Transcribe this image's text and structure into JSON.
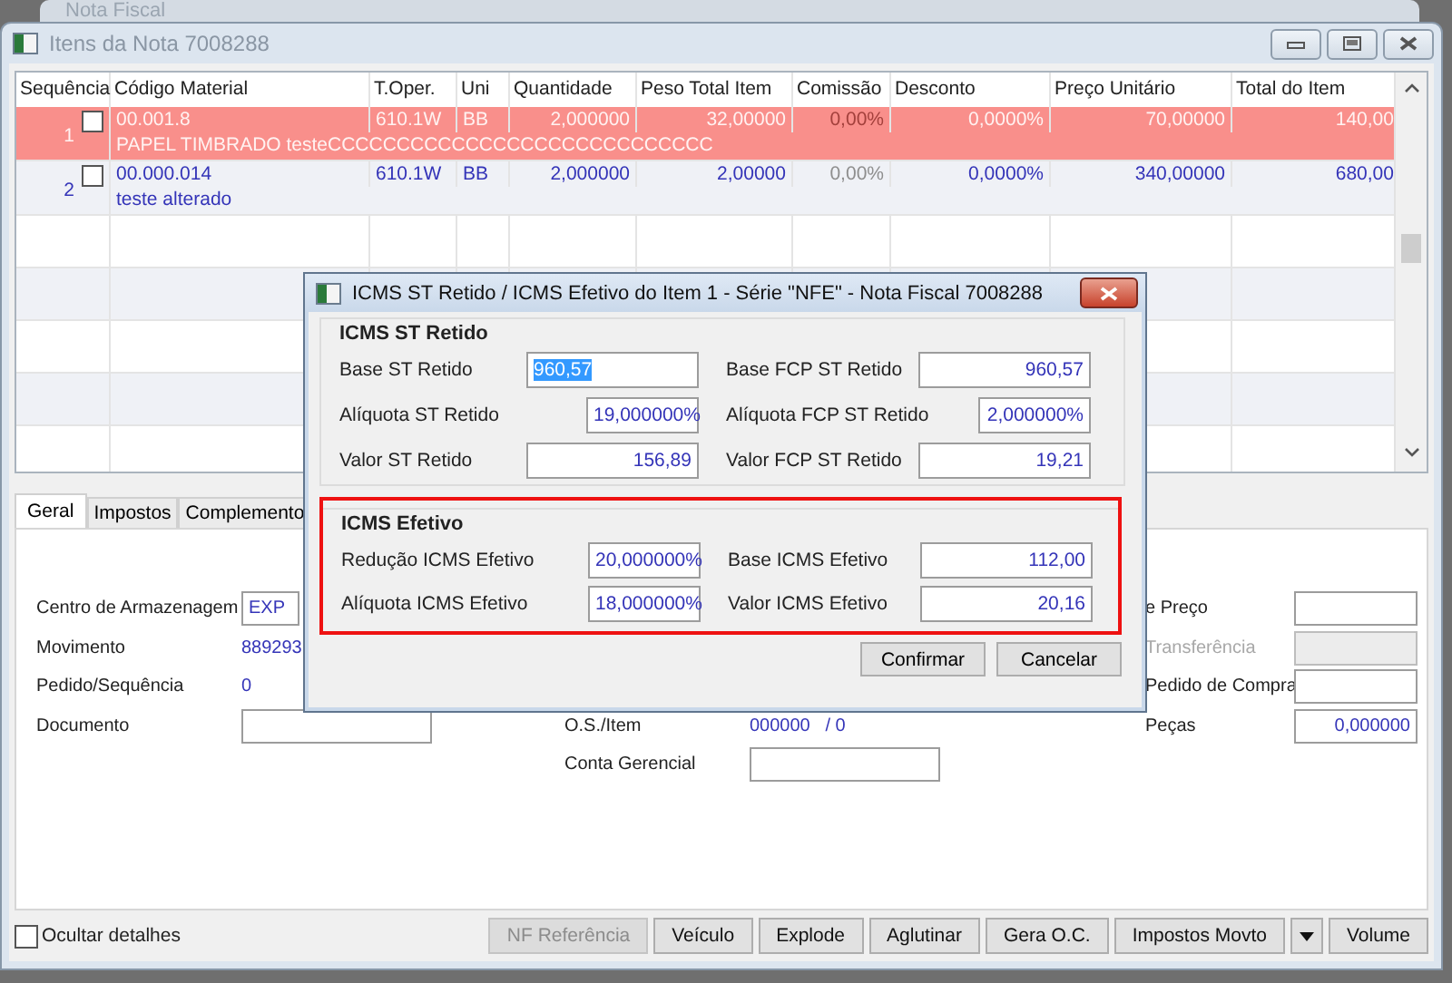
{
  "background_window": {
    "title": "Nota Fiscal"
  },
  "window": {
    "title": "Itens da Nota 7008288"
  },
  "grid": {
    "columns": [
      {
        "label": "Sequência",
        "disabled": false
      },
      {
        "label": "Código Material",
        "disabled": false
      },
      {
        "label": "T.Oper.",
        "disabled": false
      },
      {
        "label": "Uni",
        "disabled": false
      },
      {
        "label": "Quantidade",
        "disabled": false
      },
      {
        "label": "Peso Total Item",
        "disabled": false
      },
      {
        "label": "Comissão",
        "disabled": true
      },
      {
        "label": "Desconto",
        "disabled": false
      },
      {
        "label": "Preço Unitário",
        "disabled": false
      },
      {
        "label": "Total do Item",
        "disabled": false
      }
    ],
    "rows": [
      {
        "checked": false,
        "selected": true,
        "cells": [
          "1",
          "00.001.8",
          "610.1W",
          "BB",
          "2,000000",
          "32,00000",
          "0,00%",
          "0,0000%",
          "70,00000",
          "140,00"
        ],
        "description": "PAPEL TIMBRADO testeCCCCCCCCCCCCCCCCCCCCCCCCCCCC"
      },
      {
        "checked": false,
        "selected": false,
        "cells": [
          "2",
          "00.000.014",
          "610.1W",
          "BB",
          "2,000000",
          "2,00000",
          "0,00%",
          "0,0000%",
          "340,00000",
          "680,00"
        ],
        "description": "teste alterado"
      }
    ]
  },
  "tabs": [
    {
      "label": "Geral",
      "selected": true
    },
    {
      "label": "Impostos",
      "selected": false
    },
    {
      "label": "Complemento",
      "selected": false
    }
  ],
  "form": {
    "left": [
      {
        "label": "Centro de Armazenagem",
        "kind": "field",
        "value": "EXP",
        "disabled": false
      },
      {
        "label": "Movimento",
        "kind": "text",
        "value": "889293",
        "disabled": false
      },
      {
        "label": "Pedido/Sequência",
        "kind": "text",
        "value": "0",
        "disabled": false
      },
      {
        "label": "Documento",
        "kind": "field",
        "disabled": false
      }
    ],
    "middle": [
      {
        "label": "O.S./Item",
        "kind": "text",
        "value": "000000   / 0",
        "disabled": false
      },
      {
        "label": "Conta Gerencial",
        "kind": "field",
        "disabled": false
      }
    ],
    "right": [
      {
        "label": "e Preço",
        "kind": "field",
        "disabled": false
      },
      {
        "label": "Transferência",
        "kind": "field",
        "disabled": true
      },
      {
        "label": "Pedido de Compra",
        "kind": "field",
        "disabled": false
      },
      {
        "label": "Peças",
        "kind": "field",
        "value": "0,000000",
        "disabled": false
      }
    ]
  },
  "dialog": {
    "title": "ICMS ST Retido / ICMS Efetivo do Item 1 - Série \"NFE\" - Nota Fiscal 7008288",
    "groups": [
      {
        "title": "ICMS ST Retido",
        "highlighted": false,
        "fields": [
          {
            "label": "Base ST Retido",
            "value": "960,57",
            "kind": "amount",
            "selected": true
          },
          {
            "label": "Base FCP ST Retido",
            "value": "960,57",
            "kind": "amount",
            "selected": false
          },
          {
            "label": "Alíquota ST Retido",
            "value": "19,000000%",
            "kind": "percent",
            "selected": false
          },
          {
            "label": "Alíquota FCP ST Retido",
            "value": "2,000000%",
            "kind": "percent",
            "selected": false
          },
          {
            "label": "Valor ST Retido",
            "value": "156,89",
            "kind": "amount",
            "selected": false
          },
          {
            "label": "Valor FCP ST Retido",
            "value": "19,21",
            "kind": "amount",
            "selected": false
          }
        ]
      },
      {
        "title": "ICMS Efetivo",
        "highlighted": true,
        "fields": [
          {
            "label": "Redução ICMS Efetivo",
            "value": "20,000000%",
            "kind": "percent",
            "selected": false
          },
          {
            "label": "Base ICMS Efetivo",
            "value": "112,00",
            "kind": "amount",
            "selected": false
          },
          {
            "label": "Alíquota ICMS Efetivo",
            "value": "18,000000%",
            "kind": "percent",
            "selected": false
          },
          {
            "label": "Valor ICMS Efetivo",
            "value": "20,16",
            "kind": "amount",
            "selected": false
          }
        ]
      }
    ],
    "buttons": [
      "Confirmar",
      "Cancelar"
    ]
  },
  "footer": {
    "checkbox": {
      "label": "Ocultar detalhes",
      "checked": false
    },
    "buttons": [
      {
        "label": "NF Referência",
        "kind": "button",
        "disabled": true
      },
      {
        "label": "Veículo",
        "kind": "button",
        "disabled": false
      },
      {
        "label": "Explode",
        "kind": "button",
        "disabled": false
      },
      {
        "label": "Aglutinar",
        "kind": "button",
        "disabled": false
      },
      {
        "label": "Gera O.C.",
        "kind": "button",
        "disabled": false
      },
      {
        "label": "Impostos Movto",
        "kind": "button",
        "disabled": false
      },
      {
        "kind": "dropdown",
        "disabled": false
      },
      {
        "label": "Volume",
        "kind": "button",
        "disabled": false
      }
    ]
  }
}
